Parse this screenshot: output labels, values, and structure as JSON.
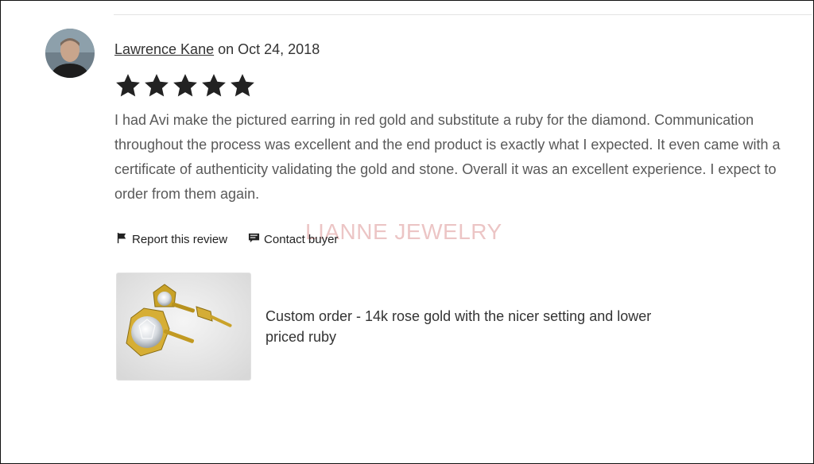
{
  "review": {
    "reviewer_name": "Lawrence Kane",
    "date_text": "on Oct 24, 2018",
    "rating": 5,
    "rating_max": 5,
    "text": "I had Avi make the pictured earring in red gold and substitute a ruby for the diamond. Communication throughout the process was excellent and the end product is exactly what I expected. It even came with a certificate of authenticity validating the gold and stone. Overall it was an excellent experience. I expect to order from them again."
  },
  "actions": {
    "report_label": "Report this review",
    "contact_label": "Contact buyer"
  },
  "watermark": "LIANNE JEWELRY",
  "product": {
    "title": "Custom order - 14k rose gold with the nicer setting and lower priced ruby"
  },
  "icons": {
    "star": "star-icon",
    "report": "flag-icon",
    "contact": "message-icon"
  },
  "colors": {
    "star": "#222222",
    "text": "#595959",
    "watermark": "#dc9696"
  }
}
